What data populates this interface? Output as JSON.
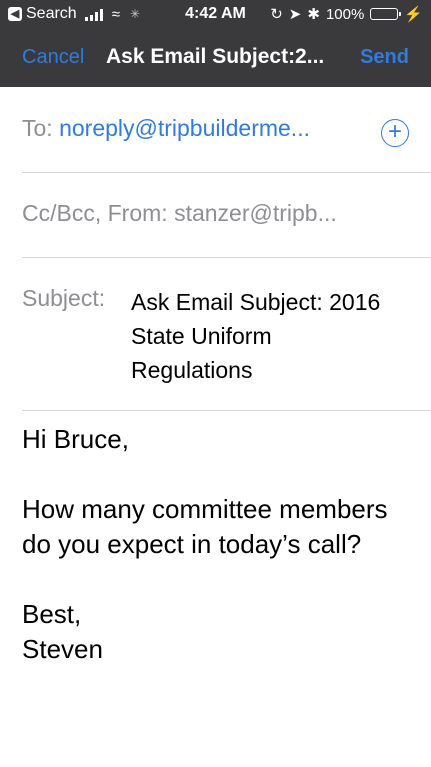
{
  "status_bar": {
    "back_app": "Search",
    "time": "4:42 AM",
    "battery": "100%",
    "battery_level": 1.0
  },
  "nav": {
    "cancel_label": "Cancel",
    "title": "Ask Email Subject:2...",
    "send_label": "Send"
  },
  "compose": {
    "to_label": "To:",
    "to_address": "noreply@tripbuilderme...",
    "cc_from_label": "Cc/Bcc, From:",
    "cc_from_value": "stanzer@tripb...",
    "subject_label": "Subject:",
    "subject_value": "Ask Email Subject: 2016 State Uniform Regulations",
    "body": "Hi Bruce,\n\nHow many committee members do you expect in today’s call?\n\nBest,\nSteven"
  },
  "colors": {
    "accent": "#2f7be0",
    "nav_background": "#3a3a3c",
    "battery_fill": "#4cd964"
  }
}
